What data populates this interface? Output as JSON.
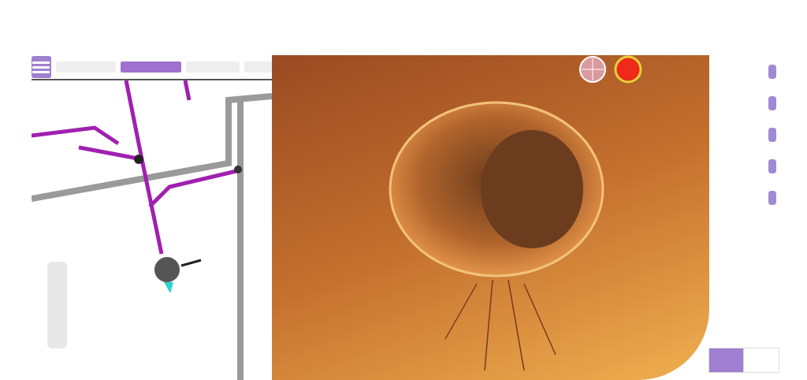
{
  "menu_tabs": [
    {
      "selected": false
    },
    {
      "selected": true
    },
    {
      "selected": false
    },
    {
      "selected": false
    }
  ],
  "camera": {
    "recording": true
  },
  "bottom_buttons": [
    {
      "selected": true
    },
    {
      "selected": false
    }
  ]
}
